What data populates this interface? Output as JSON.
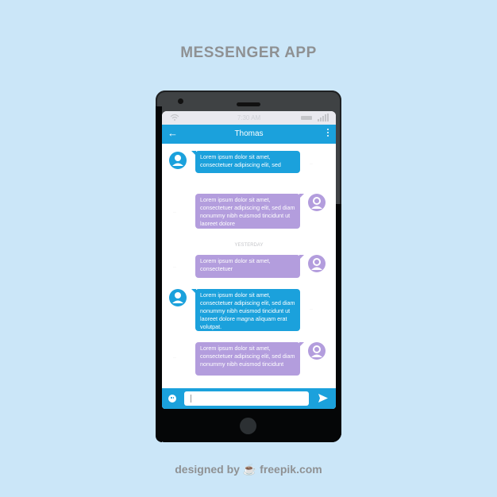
{
  "page": {
    "heading": "MESSENGER APP",
    "credit_prefix": "designed by",
    "credit_brand": "freepik.com"
  },
  "status_bar": {
    "time": "7:30 AM",
    "icons": [
      "wifi-icon",
      "battery-icon",
      "signal-icon"
    ]
  },
  "app_bar": {
    "back_icon": "arrow-left-icon",
    "contact_name": "Thomas",
    "menu_icon": "more-vertical-icon"
  },
  "chat": {
    "day_separator": "YESTERDAY",
    "messages": [
      {
        "direction": "incoming",
        "text": "Lorem ipsum dolor sit amet, consectetuer adipiscing elit, sed",
        "avatar": "male-user-icon"
      },
      {
        "direction": "outgoing",
        "text": "Lorem ipsum dolor sit amet, consectetuer adipiscing elit, sed diam nonummy nibh euismod tincidunt ut laoreet dolore",
        "avatar": "female-user-icon"
      },
      {
        "direction": "outgoing",
        "text": "Lorem ipsum dolor sit amet, consectetuer",
        "avatar": "female-user-icon"
      },
      {
        "direction": "incoming",
        "text": "Lorem ipsum dolor sit amet, consectetuer adipiscing elit, sed diam nonummy nibh euismod tincidunt ut laoreet dolore magna aliquam erat volutpat.",
        "avatar": "male-user-icon"
      },
      {
        "direction": "outgoing",
        "text": "Lorem ipsum dolor sit amet, consectetuer adipiscing elit, sed diam nonummy nibh euismod tincidunt",
        "avatar": "female-user-icon"
      }
    ]
  },
  "composer": {
    "emoji_icon": "smiley-icon",
    "input_value": "",
    "send_icon": "send-icon"
  },
  "colors": {
    "background": "#cbe6f8",
    "incoming_bubble": "#1ba1dc",
    "outgoing_bubble": "#b39ddd",
    "app_bar": "#1ba1dc",
    "phone_body": "#3f4244"
  }
}
